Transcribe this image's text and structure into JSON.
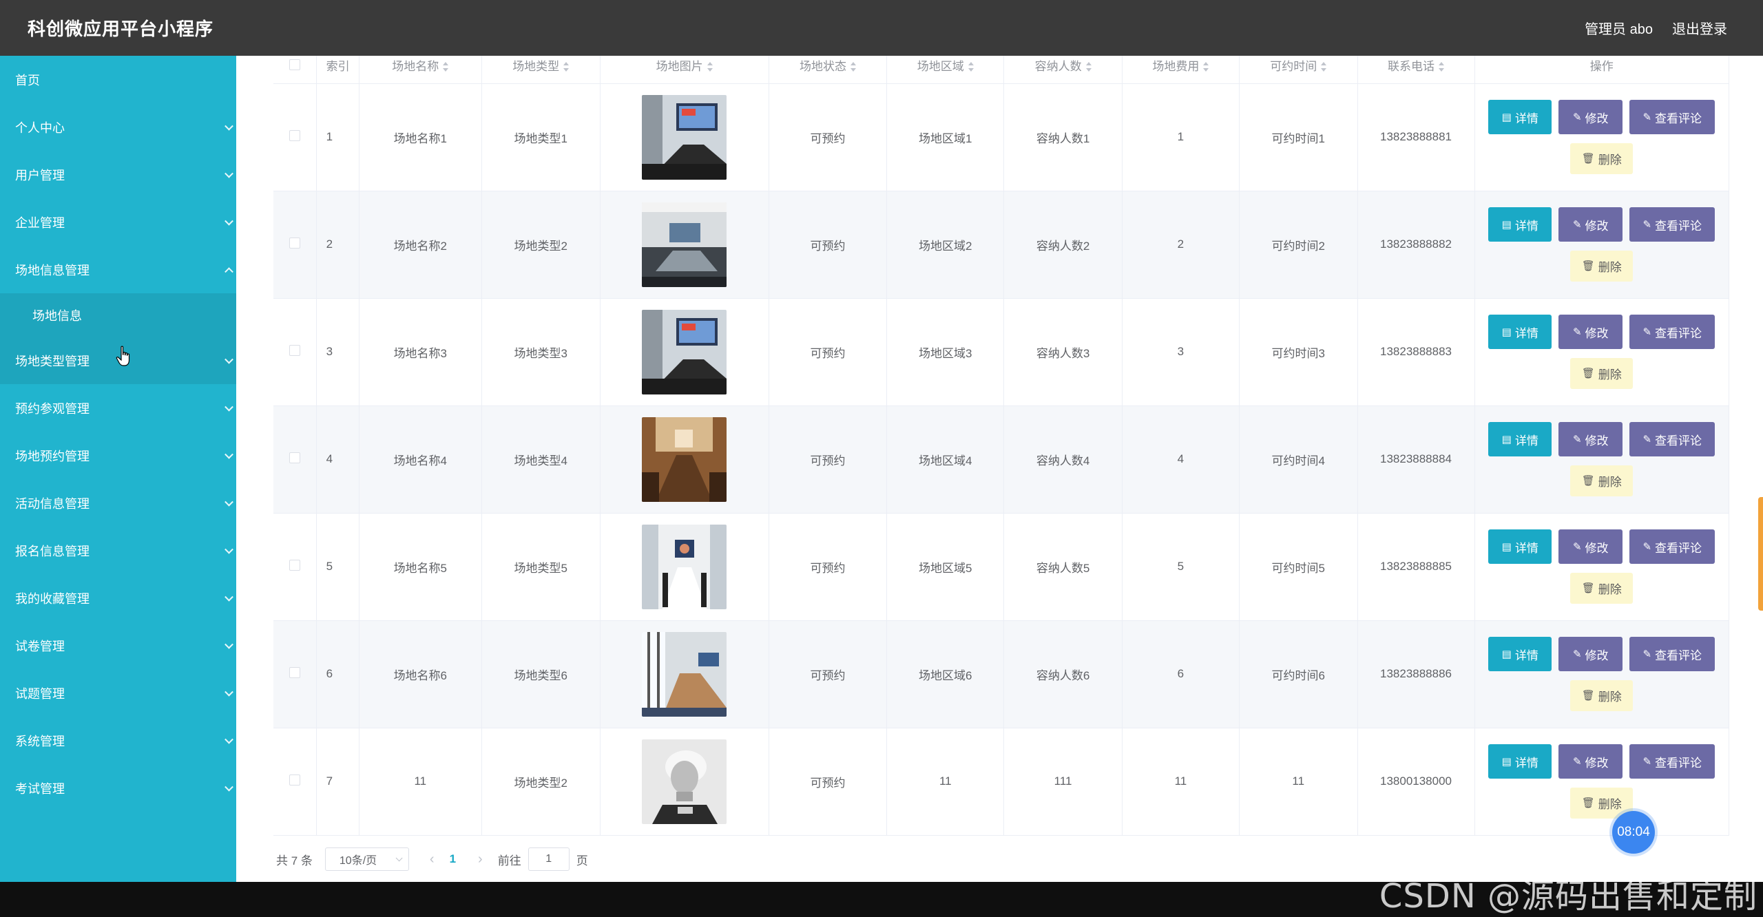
{
  "header": {
    "title": "科创微应用平台小程序",
    "user": "管理员 abo",
    "logout": "退出登录"
  },
  "sidebar": {
    "items": [
      {
        "label": "首页",
        "chevron": "none"
      },
      {
        "label": "个人中心",
        "chevron": "down"
      },
      {
        "label": "用户管理",
        "chevron": "down"
      },
      {
        "label": "企业管理",
        "chevron": "down"
      },
      {
        "label": "场地信息管理",
        "chevron": "up"
      },
      {
        "label": "场地信息",
        "chevron": "none",
        "sub": true
      },
      {
        "label": "场地类型管理",
        "chevron": "down",
        "hover": true
      },
      {
        "label": "预约参观管理",
        "chevron": "down"
      },
      {
        "label": "场地预约管理",
        "chevron": "down"
      },
      {
        "label": "活动信息管理",
        "chevron": "down"
      },
      {
        "label": "报名信息管理",
        "chevron": "down"
      },
      {
        "label": "我的收藏管理",
        "chevron": "down"
      },
      {
        "label": "试卷管理",
        "chevron": "down"
      },
      {
        "label": "试题管理",
        "chevron": "down"
      },
      {
        "label": "系统管理",
        "chevron": "down"
      },
      {
        "label": "考试管理",
        "chevron": "down"
      }
    ]
  },
  "table": {
    "columns": [
      "索引",
      "场地名称",
      "场地类型",
      "场地图片",
      "场地状态",
      "场地区域",
      "容纳人数",
      "场地费用",
      "可约时间",
      "联系电话",
      "操作"
    ],
    "rows": [
      {
        "index": "1",
        "name": "场地名称1",
        "type": "场地类型1",
        "image": "meeting-room-screen",
        "status": "可预约",
        "area": "场地区域1",
        "capacity": "容纳人数1",
        "fee": "1",
        "time": "可约时间1",
        "phone": "13823888881"
      },
      {
        "index": "2",
        "name": "场地名称2",
        "type": "场地类型2",
        "image": "conference-room-grey",
        "status": "可预约",
        "area": "场地区域2",
        "capacity": "容纳人数2",
        "fee": "2",
        "time": "可约时间2",
        "phone": "13823888882"
      },
      {
        "index": "3",
        "name": "场地名称3",
        "type": "场地类型3",
        "image": "meeting-room-screen",
        "status": "可预约",
        "area": "场地区域3",
        "capacity": "容纳人数3",
        "fee": "3",
        "time": "可约时间3",
        "phone": "13823888883"
      },
      {
        "index": "4",
        "name": "场地名称4",
        "type": "场地类型4",
        "image": "boardroom-wood",
        "status": "可预约",
        "area": "场地区域4",
        "capacity": "容纳人数4",
        "fee": "4",
        "time": "可约时间4",
        "phone": "13823888884"
      },
      {
        "index": "5",
        "name": "场地名称5",
        "type": "场地类型5",
        "image": "meeting-room-white",
        "status": "可预约",
        "area": "场地区域5",
        "capacity": "容纳人数5",
        "fee": "5",
        "time": "可约时间5",
        "phone": "13823888885"
      },
      {
        "index": "6",
        "name": "场地名称6",
        "type": "场地类型6",
        "image": "conference-room-windows",
        "status": "可预约",
        "area": "场地区域6",
        "capacity": "容纳人数6",
        "fee": "6",
        "time": "可约时间6",
        "phone": "13823888886"
      },
      {
        "index": "7",
        "name": "11",
        "type": "场地类型2",
        "image": "portrait-photo",
        "status": "可预约",
        "area": "11",
        "capacity": "111",
        "fee": "11",
        "time": "11",
        "phone": "13800138000"
      }
    ],
    "actions": {
      "detail": "详情",
      "edit": "修改",
      "comments": "查看评论",
      "delete": "删除"
    }
  },
  "pagination": {
    "total": "共 7 条",
    "page_size": "10条/页",
    "current_page": "1",
    "goto_label": "前往",
    "goto_value": "1",
    "page_suffix": "页"
  },
  "timer": "08:04",
  "watermark": "CSDN @源码出售和定制",
  "colors": {
    "header": "#3a3a3a",
    "sidebar": "#21b4ce",
    "detail_button": "#1aa9c6",
    "edit_button": "#6c6aa5",
    "delete_button": "#fcf7cf"
  }
}
